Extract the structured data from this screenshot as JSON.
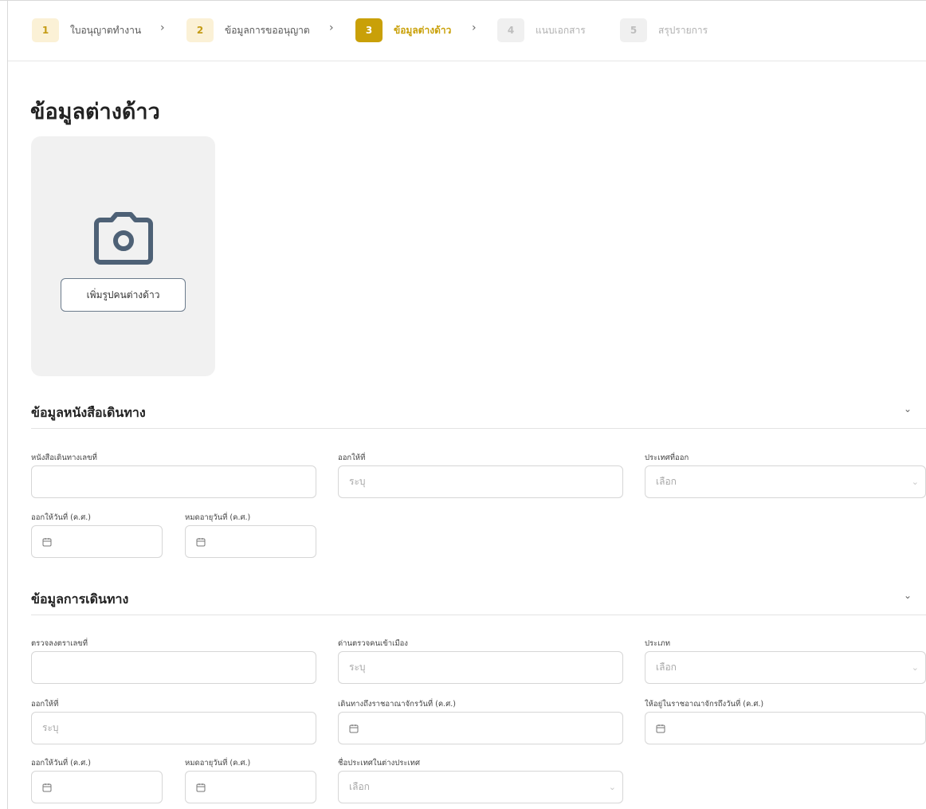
{
  "stepper": {
    "steps": [
      {
        "num": "1",
        "label": "ใบอนุญาตทำงาน",
        "state": "done"
      },
      {
        "num": "2",
        "label": "ข้อมูลการขออนุญาต",
        "state": "done"
      },
      {
        "num": "3",
        "label": "ข้อมูลต่างด้าว",
        "state": "active"
      },
      {
        "num": "4",
        "label": "แนบเอกสาร",
        "state": "todo"
      },
      {
        "num": "5",
        "label": "สรุปรายการ",
        "state": "todo"
      }
    ],
    "separator": "›"
  },
  "page": {
    "title": "ข้อมูลต่างด้าว"
  },
  "photo": {
    "button_label": "เพิ่มรูปคนต่างด้าว"
  },
  "passport": {
    "title": "ข้อมูลหนังสือเดินทาง",
    "fields": {
      "passport_no": {
        "label": "หนังสือเดินทางเลขที่",
        "value": ""
      },
      "issued_at": {
        "label": "ออกให้ที่",
        "placeholder": "ระบุ"
      },
      "issuing_country": {
        "label": "ประเทศที่ออก",
        "placeholder": "เลือก"
      },
      "issue_date": {
        "label": "ออกให้วันที่ (ค.ศ.)"
      },
      "expiry_date": {
        "label": "หมดอายุวันที่ (ค.ศ.)"
      }
    }
  },
  "travel": {
    "title": "ข้อมูลการเดินทาง",
    "fields": {
      "visa_no": {
        "label": "ตรวจลงตราเลขที่",
        "value": ""
      },
      "checkpoint": {
        "label": "ด่านตรวจคนเข้าเมือง",
        "placeholder": "ระบุ"
      },
      "visa_type": {
        "label": "ประเภท",
        "placeholder": "เลือก"
      },
      "visa_issued_at": {
        "label": "ออกให้ที่",
        "placeholder": "ระบุ"
      },
      "arrival_date": {
        "label": "เดินทางถึงราชอาณาจักรวันที่ (ค.ศ.)"
      },
      "stay_until": {
        "label": "ให้อยู่ในราชอาณาจักรถึงวันที่ (ค.ศ.)"
      },
      "visa_issue_date": {
        "label": "ออกให้วันที่ (ค.ศ.)"
      },
      "visa_expiry_date": {
        "label": "หมดอายุวันที่ (ค.ศ.)"
      },
      "country_abroad": {
        "label": "ชื่อประเทศในต่างประเทศ",
        "placeholder": "เลือก"
      }
    }
  },
  "icons": {
    "camera": "camera-icon",
    "calendar": "calendar-icon",
    "chevron": "chevron-down-icon"
  },
  "colors": {
    "accent": "#c9a008",
    "accent_light": "#fbf1d6",
    "icon": "#4e6176"
  }
}
